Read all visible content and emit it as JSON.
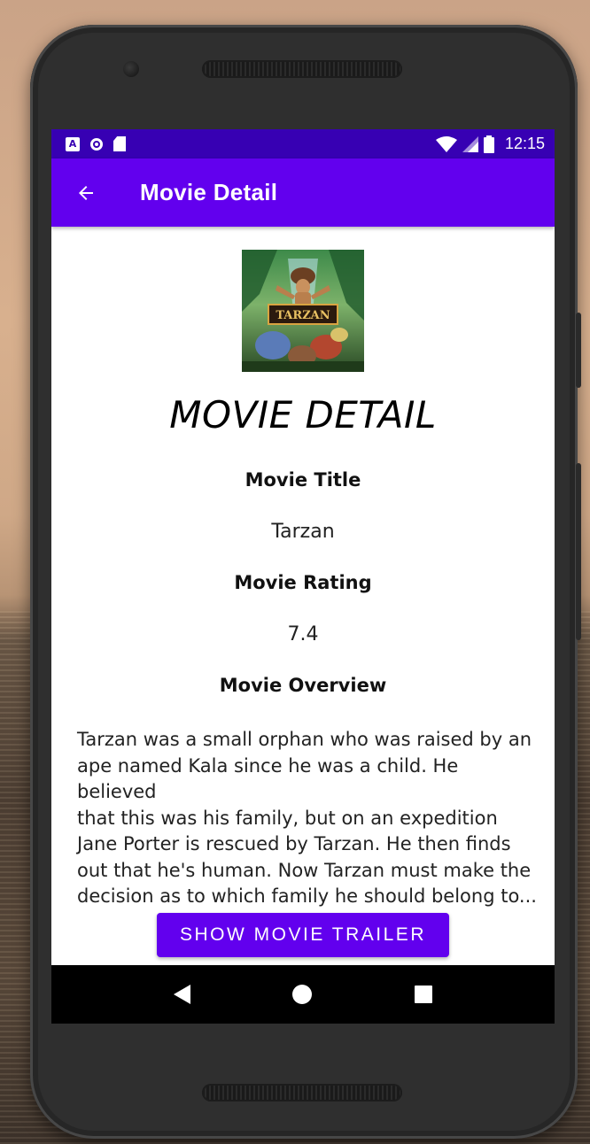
{
  "status_bar": {
    "time": "12:15",
    "icons": [
      "accessibility-a-icon",
      "circle-notification-icon",
      "sd-card-icon",
      "wifi-icon",
      "signal-icon",
      "battery-icon"
    ]
  },
  "app_bar": {
    "back_icon": "arrow-left-icon",
    "title": "Movie Detail"
  },
  "movie": {
    "poster_title_text": "TARZAN",
    "heading": "MOVIE DETAIL",
    "title_label": "Movie Title",
    "title_value": "Tarzan",
    "rating_label": "Movie Rating",
    "rating_value": "7.4",
    "overview_label": "Movie Overview",
    "overview_lines": [
      "Tarzan was a small orphan who was raised by an",
      "ape named Kala since he was a child. He believed",
      "that this was his family, but on an expedition",
      "Jane Porter is rescued by Tarzan. He then finds",
      "out that he's human. Now Tarzan must make the",
      "decision as to which family he should belong to..."
    ],
    "trailer_button": "SHOW MOVIE TRAILER"
  },
  "nav_bar": {
    "icons": [
      "back-triangle-icon",
      "home-circle-icon",
      "recents-square-icon"
    ]
  },
  "colors": {
    "status_bar": "#3700b3",
    "primary": "#6200ee",
    "nav_bar": "#000000"
  }
}
